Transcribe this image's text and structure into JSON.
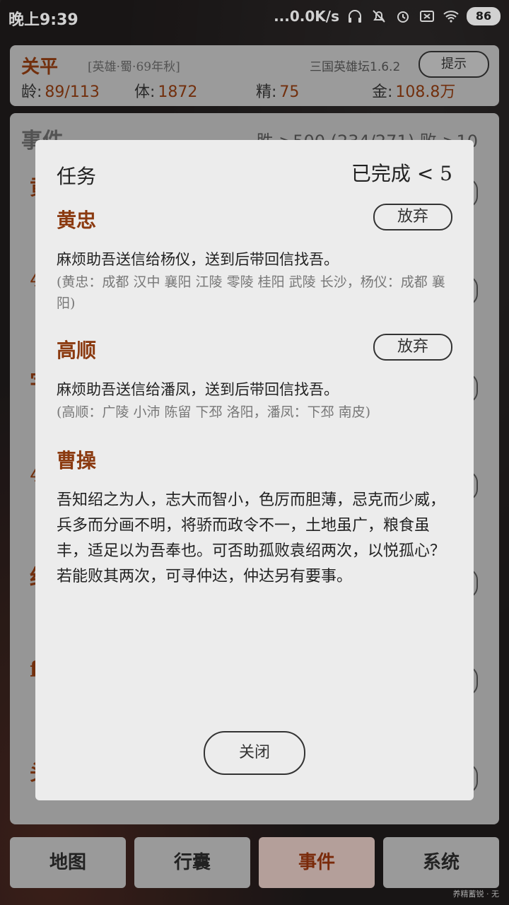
{
  "status_bar": {
    "time": "晚上9:39",
    "net_speed": "...0.0K/s",
    "battery": "86"
  },
  "hero": {
    "name": "关平",
    "tag": "[英雄·蜀·69年秋]",
    "version": "三国英雄坛1.6.2",
    "hint_label": "提示",
    "stats": [
      {
        "label": "龄:",
        "value": "89/113"
      },
      {
        "label": "体:",
        "value": "1872"
      },
      {
        "label": "精:",
        "value": "75"
      },
      {
        "label": "金:",
        "value": "108.8万"
      }
    ]
  },
  "events": {
    "title": "事件",
    "record": "胜 >500 (234/271) 败 >10",
    "left_chars": [
      "黄",
      "4",
      "字",
      "4",
      "红",
      "f",
      "头"
    ]
  },
  "modal": {
    "title": "任务",
    "status": "已完成 < 5",
    "quests": [
      {
        "name": "黄忠",
        "abandon_label": "放弃",
        "text": "麻烦助吾送信给杨仪，送到后带回信找吾。",
        "sub": "(黄忠：成都 汉中 襄阳 江陵 零陵 桂阳 武陵 长沙，杨仪：成都 襄阳)"
      },
      {
        "name": "高顺",
        "abandon_label": "放弃",
        "text": "麻烦助吾送信给潘凤，送到后带回信找吾。",
        "sub": "(高顺：广陵 小沛 陈留 下邳 洛阳，潘凤：下邳 南皮)"
      },
      {
        "name": "曹操",
        "text": "吾知绍之为人，志大而智小，色厉而胆薄，忌克而少威，兵多而分画不明，将骄而政令不一，土地虽广，粮食虽丰，适足以为吾奉也。可否助孤败袁绍两次，以悦孤心？若能败其两次，可寻仲达，仲达另有要事。"
      }
    ],
    "close_label": "关闭"
  },
  "nav": [
    {
      "label": "地图"
    },
    {
      "label": "行囊"
    },
    {
      "label": "事件"
    },
    {
      "label": "系统"
    }
  ],
  "footer": "养精蓄锐 · 无"
}
